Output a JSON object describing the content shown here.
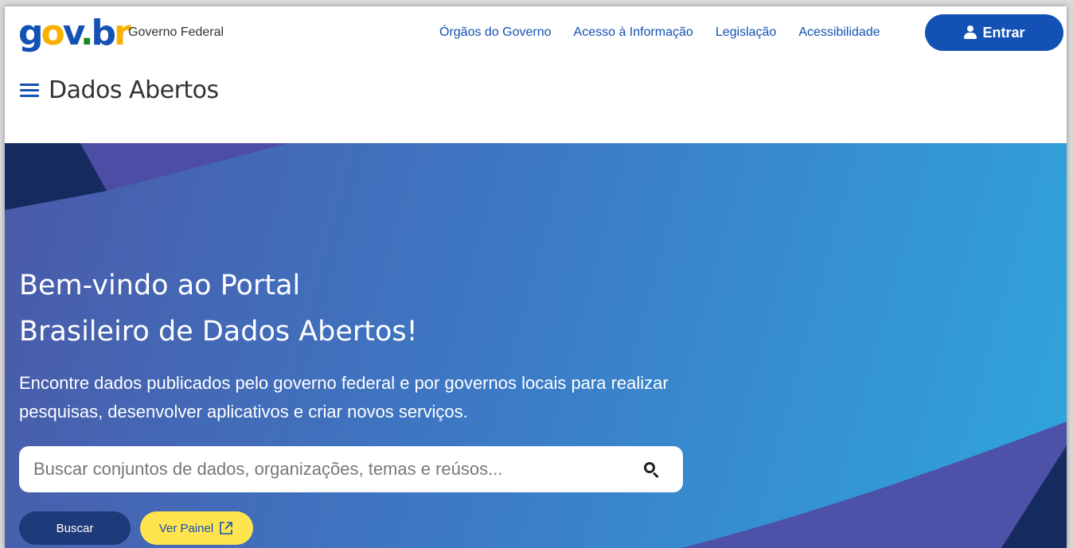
{
  "header": {
    "logo_text": "gov.br",
    "org_name": "Governo Federal",
    "links": [
      {
        "label": "Órgãos do Governo"
      },
      {
        "label": "Acesso à Informação"
      },
      {
        "label": "Legislação"
      },
      {
        "label": "Acessibilidade"
      }
    ],
    "login_label": "Entrar",
    "site_title": "Dados Abertos"
  },
  "hero": {
    "title_line1": "Bem-vindo ao Portal",
    "title_line2": "Brasileiro de Dados Abertos!",
    "description": "Encontre dados publicados pelo governo federal e por governos locais para realizar pesquisas, desenvolver aplicativos e criar novos serviços.",
    "search_placeholder": "Buscar conjuntos de dados, organizações, temas e reúsos...",
    "search_value": "",
    "buscar_label": "Buscar",
    "painel_label": "Ver Painel"
  },
  "colors": {
    "brand_blue": "#1351b4",
    "accent_yellow": "#ffe34f",
    "dark_navy": "#1f3a7a"
  },
  "icons": {
    "menu": "hamburger-menu-icon",
    "user": "user-icon",
    "search": "search-icon",
    "external": "external-link-icon"
  }
}
